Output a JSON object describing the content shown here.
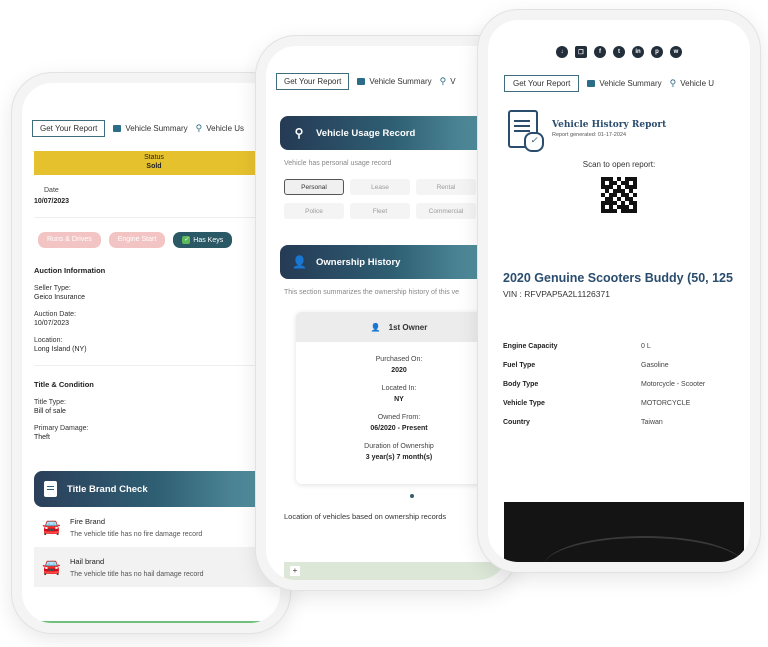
{
  "nav": {
    "get_report": "Get Your Report",
    "vehicle_summary": "Vehicle Summary",
    "vehicle_usage": "Vehicle Us",
    "vehicle_usage_short": "V",
    "vehicle_usage_p3": "Vehicle U"
  },
  "phone1": {
    "status_label": "Status",
    "status_value": "Sold",
    "date_label": "Date",
    "date_value": "10/07/2023",
    "pills": [
      "Runs & Drives",
      "Engine Start",
      "Has Keys"
    ],
    "auction_title": "Auction Information",
    "seller_type_label": "Seller Type:",
    "seller_type_value": "Geico Insurance",
    "auction_date_label": "Auction Date:",
    "auction_date_value": "10/07/2023",
    "location_label": "Location:",
    "location_value": "Long Island (NY)",
    "title_condition": "Title & Condition",
    "title_type_label": "Title Type:",
    "title_type_value": "Bill of sale",
    "primary_damage_label": "Primary Damage:",
    "primary_damage_value": "Theft",
    "brand_check_title": "Title Brand Check",
    "brands": [
      {
        "title": "Fire Brand",
        "desc": "The vehicle title has no fire damage record"
      },
      {
        "title": "Hail brand",
        "desc": "The vehicle title has no hail damage record"
      }
    ]
  },
  "phone2": {
    "usage_title": "Vehicle Usage Record",
    "usage_note": "Vehicle has personal usage record",
    "usage_types": [
      "Personal",
      "Lease",
      "Rental",
      "Police",
      "Fleet",
      "Commercial"
    ],
    "ownership_title": "Ownership History",
    "ownership_note": "This section summarizes the ownership history of this ve",
    "owner_title": "1st Owner",
    "purchased_label": "Purchased On:",
    "purchased_value": "2020",
    "located_label": "Located In:",
    "located_value": "NY",
    "owned_from_label": "Owned From:",
    "owned_from_value": "06/2020 - Present",
    "duration_label": "Duration of Ownership",
    "duration_value": "3 year(s) 7 month(s)",
    "location_caption": "Location of vehicles based on ownership records",
    "map_plus": "+"
  },
  "phone3": {
    "share_icons": [
      "cloud-download-icon",
      "copy-icon",
      "facebook-icon",
      "twitter-icon",
      "linkedin-icon",
      "pinterest-icon",
      "whatsapp-icon"
    ],
    "report_title": "Vehicle History Report",
    "report_generated": "Report generated: 01-17-2024",
    "scan_text": "Scan to open report:",
    "vehicle_title": "2020 Genuine Scooters Buddy (50, 125",
    "vin": "VIN : RFVPAP5A2L1126371",
    "specs": [
      {
        "key": "Engine Capacity",
        "value": "0 L"
      },
      {
        "key": "Fuel Type",
        "value": "Gasoline"
      },
      {
        "key": "Body Type",
        "value": "Motorcycle - Scooter"
      },
      {
        "key": "Vehicle Type",
        "value": "MOTORCYCLE"
      },
      {
        "key": "Country",
        "value": "Taiwan"
      }
    ]
  },
  "colors": {
    "status_yellow": "#e6c12e",
    "teal_dark": "#2f5f73",
    "navy": "#2a4d6e",
    "pill_pink": "#f3c4c4",
    "keys_green": "#5cb85c"
  }
}
